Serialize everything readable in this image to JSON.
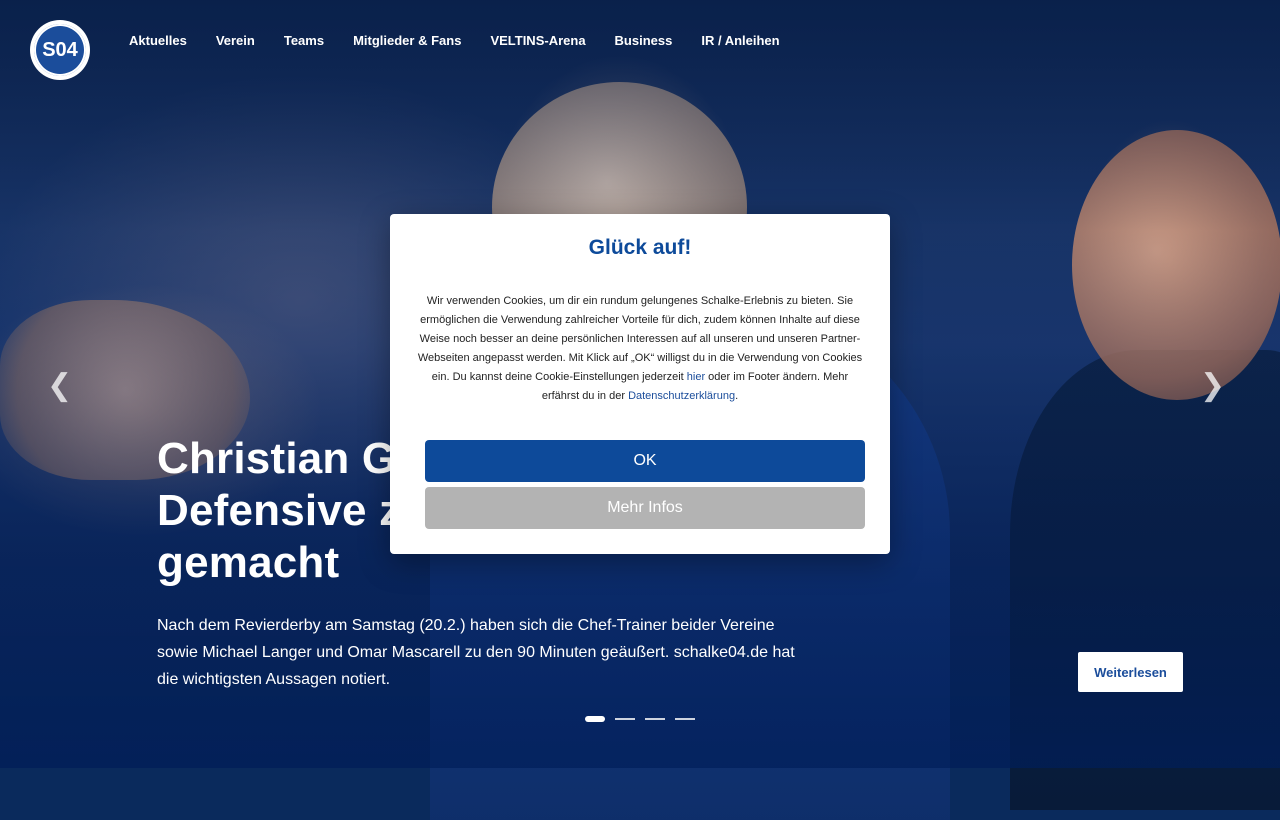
{
  "brand": {
    "logo_text": "S04",
    "accent": "#0d4a9a"
  },
  "nav": {
    "items": [
      "Aktuelles",
      "Verein",
      "Teams",
      "Mitglieder & Fans",
      "VELTINS-Arena",
      "Business",
      "IR / Anleihen"
    ]
  },
  "hero": {
    "headline_visible": "Christian Gr",
    "headline_line2": "Defensive z",
    "headline_line3": "gemacht",
    "lede": "Nach dem Revierderby am Samstag (20.2.) haben sich die Chef-Trainer beider Vereine sowie Michael Langer und Omar Mascarell zu den 90 Minuten geäußert. schalke04.de hat die wichtigsten Aussagen notiert.",
    "read_more": "Weiterlesen",
    "prev_icon": "chevron-left-icon",
    "next_icon": "chevron-right-icon",
    "slides_count": 4,
    "active_slide": 1
  },
  "cookie_modal": {
    "title": "Glück auf!",
    "text_before_link1": "Wir verwenden Cookies, um dir ein rundum gelungenes Schalke-Erlebnis zu bieten. Sie ermöglichen die Verwendung zahlreicher Vorteile für dich, zudem können Inhalte auf diese Weise noch besser an deine persönlichen Interessen auf all unseren und unseren Partner-Webseiten angepasst werden. Mit Klick auf „OK“ willigst du in die Verwendung von Cookies ein. Du kannst deine Cookie-Einstellungen jederzeit ",
    "link1": "hier",
    "text_between": " oder im Footer ändern. Mehr erfährst du in der ",
    "link2": "Datenschutzerklärung",
    "text_after": ".",
    "ok_label": "OK",
    "more_label": "Mehr Infos"
  }
}
